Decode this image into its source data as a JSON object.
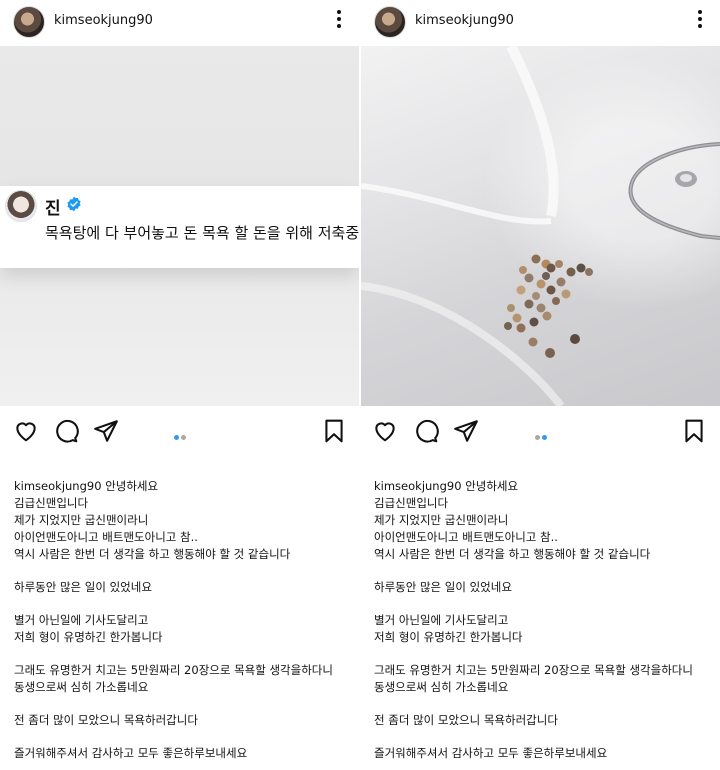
{
  "posts": [
    {
      "username": "kimseokjung90",
      "tweet": {
        "name": "진",
        "text": "목욕탕에 다 부어놓고 돈 목욕 할 돈을 위해 저축중"
      },
      "carousel": {
        "count": 2,
        "active": 1
      },
      "caption": {
        "username": "kimseokjung90",
        "lines": [
          "안녕하세요",
          "김급신맨입니다",
          "제가 지었지만 굽신맨이라니",
          "아이언맨도아니고 배트맨도아니고 참..",
          "역시 사람은 한번 더 생각을 하고 행동해야 할 것 같습니다",
          "",
          "하루동안 많은 일이 있었네요",
          "",
          "별거 아닌일에 기사도달리고",
          "저희 형이 유명하긴 한가봅니다",
          "",
          "그래도 유명한거 치고는 5만원짜리 20장으로 목욕할 생각을하다니",
          "동생으로써 심히 가소롭네요",
          "",
          "전 좀더 많이 모았으니 목욕하러갑니다",
          "",
          "즐거워해주셔서 감사하고 모두 좋은하루보내세요"
        ]
      }
    },
    {
      "username": "kimseokjung90",
      "carousel": {
        "count": 2,
        "active": 2
      },
      "caption": {
        "username": "kimseokjung90",
        "lines": [
          "안녕하세요",
          "김급신맨입니다",
          "제가 지었지만 굽신맨이라니",
          "아이언맨도아니고 배트맨도아니고 참..",
          "역시 사람은 한번 더 생각을 하고 행동해야 할 것 같습니다",
          "",
          "하루동안 많은 일이 있었네요",
          "",
          "별거 아닌일에 기사도달리고",
          "저희 형이 유명하긴 한가봅니다",
          "",
          "그래도 유명한거 치고는 5만원짜리 20장으로 목욕할 생각을하다니",
          "동생으로써 심히 가소롭네요",
          "",
          "전 좀더 많이 모았으니 목욕하러갑니다",
          "",
          "즐거워해주셔서 감사하고 모두 좋은하루보내세요"
        ]
      }
    }
  ],
  "icons": {
    "like": "heart-icon",
    "comment": "comment-icon",
    "share": "send-icon",
    "save": "bookmark-icon",
    "more": "more-vertical-icon",
    "verified": "verified-badge-icon"
  },
  "colors": {
    "active_dot": "#3897f0",
    "inactive_dot": "#a8a8a8",
    "verified": "#1d9bf0"
  }
}
